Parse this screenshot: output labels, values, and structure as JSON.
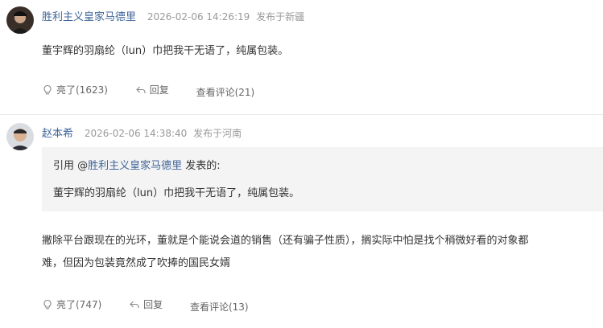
{
  "comments": [
    {
      "username": "胜利主义皇家马德里",
      "time": "2026-02-06 14:26:19",
      "location": "发布于新疆",
      "content": "董宇辉的羽扇纶（lun）巾把我干无语了，纯属包装。",
      "actions": {
        "like_label": "亮了(1623)",
        "reply_label": "回复",
        "view_replies_label": "查看评论(21)"
      }
    },
    {
      "username": "赵本希",
      "time": "2026-02-06 14:38:40",
      "location": "发布于河南",
      "quote": {
        "prefix": "引用 @",
        "user": "胜利主义皇家马德里",
        "suffix": " 发表的:",
        "text": "董宇辉的羽扇纶（lun）巾把我干无语了，纯属包装。"
      },
      "content_line1": "撇除平台跟现在的光环，董就是个能说会道的销售（还有骗子性质），搁实际中怕是找个稍微好看的对象都",
      "content_line2": "难，但因为包装竟然成了吹捧的国民女婿",
      "actions": {
        "like_label": "亮了(747)",
        "reply_label": "回复",
        "view_replies_label": "查看评论(13)"
      }
    }
  ]
}
